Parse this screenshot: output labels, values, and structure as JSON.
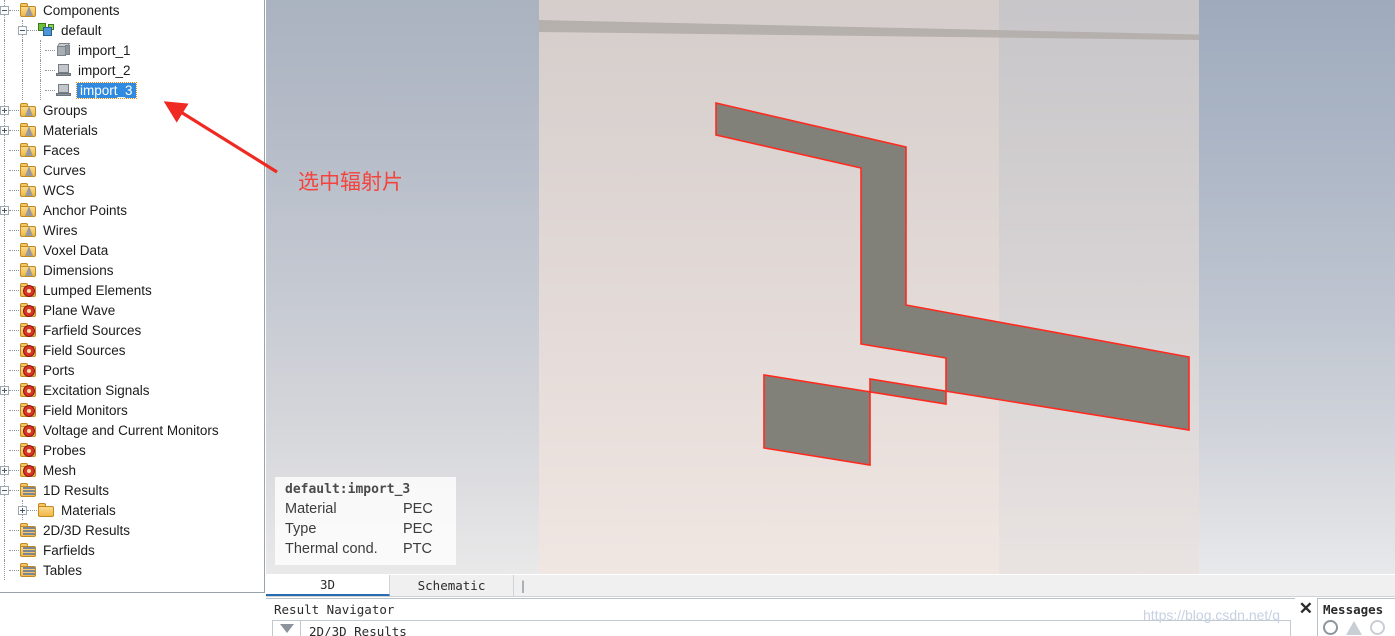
{
  "tree": {
    "items": [
      {
        "label": "Components",
        "depth": 0,
        "twisty": "minus",
        "icon": "folder-cone-icon"
      },
      {
        "label": "default",
        "depth": 1,
        "twisty": "minus",
        "icon": "component-group-icon"
      },
      {
        "label": "import_1",
        "depth": 2,
        "twisty": "none",
        "icon": "solid-body-icon"
      },
      {
        "label": "import_2",
        "depth": 2,
        "twisty": "none",
        "icon": "sheet-body-icon"
      },
      {
        "label": "import_3",
        "depth": 2,
        "twisty": "none",
        "icon": "sheet-body-icon",
        "selected": true
      },
      {
        "label": "Groups",
        "depth": 0,
        "twisty": "plus",
        "icon": "folder-cone-icon"
      },
      {
        "label": "Materials",
        "depth": 0,
        "twisty": "plus",
        "icon": "folder-cone-icon"
      },
      {
        "label": "Faces",
        "depth": 0,
        "twisty": "none",
        "icon": "folder-cone-icon"
      },
      {
        "label": "Curves",
        "depth": 0,
        "twisty": "none",
        "icon": "folder-cone-icon"
      },
      {
        "label": "WCS",
        "depth": 0,
        "twisty": "none",
        "icon": "folder-cone-icon"
      },
      {
        "label": "Anchor Points",
        "depth": 0,
        "twisty": "plus",
        "icon": "folder-cone-icon"
      },
      {
        "label": "Wires",
        "depth": 0,
        "twisty": "none",
        "icon": "folder-cone-icon"
      },
      {
        "label": "Voxel Data",
        "depth": 0,
        "twisty": "none",
        "icon": "folder-cone-icon"
      },
      {
        "label": "Dimensions",
        "depth": 0,
        "twisty": "none",
        "icon": "folder-cone-icon"
      },
      {
        "label": "Lumped Elements",
        "depth": 0,
        "twisty": "none",
        "icon": "folder-gear-icon"
      },
      {
        "label": "Plane Wave",
        "depth": 0,
        "twisty": "none",
        "icon": "folder-gear-icon"
      },
      {
        "label": "Farfield Sources",
        "depth": 0,
        "twisty": "none",
        "icon": "folder-gear-icon"
      },
      {
        "label": "Field Sources",
        "depth": 0,
        "twisty": "none",
        "icon": "folder-gear-icon"
      },
      {
        "label": "Ports",
        "depth": 0,
        "twisty": "none",
        "icon": "folder-gear-icon"
      },
      {
        "label": "Excitation Signals",
        "depth": 0,
        "twisty": "plus",
        "icon": "folder-gear-icon"
      },
      {
        "label": "Field Monitors",
        "depth": 0,
        "twisty": "none",
        "icon": "folder-gear-icon"
      },
      {
        "label": "Voltage and Current Monitors",
        "depth": 0,
        "twisty": "none",
        "icon": "folder-gear-icon"
      },
      {
        "label": "Probes",
        "depth": 0,
        "twisty": "none",
        "icon": "folder-gear-icon"
      },
      {
        "label": "Mesh",
        "depth": 0,
        "twisty": "plus",
        "icon": "folder-gear-icon"
      },
      {
        "label": "1D Results",
        "depth": 0,
        "twisty": "minus",
        "icon": "folder-results-icon"
      },
      {
        "label": "Materials",
        "depth": 1,
        "twisty": "plus",
        "icon": "folder-plain-icon"
      },
      {
        "label": "2D/3D Results",
        "depth": 0,
        "twisty": "none",
        "icon": "folder-results-icon"
      },
      {
        "label": "Farfields",
        "depth": 0,
        "twisty": "none",
        "icon": "folder-results-icon"
      },
      {
        "label": "Tables",
        "depth": 0,
        "twisty": "none",
        "icon": "folder-results-icon"
      }
    ]
  },
  "annotation": {
    "text": "选中辐射片",
    "color": "#f4433c"
  },
  "viewport": {
    "selection_outline_color": "#ff2a1f",
    "patch_fill_color": "#828179",
    "info": {
      "title": "default:import_3",
      "rows": [
        {
          "key": "Material",
          "value": "PEC"
        },
        {
          "key": "Type",
          "value": "PEC"
        },
        {
          "key": "Thermal cond.",
          "value": "PTC"
        }
      ]
    }
  },
  "view_tabs": {
    "items": [
      {
        "label": "3D",
        "active": true
      },
      {
        "label": "Schematic",
        "active": false
      }
    ],
    "caret": "|"
  },
  "result_navigator": {
    "title": "Result Navigator",
    "column_label": "2D/3D Results",
    "close_label": "✕"
  },
  "messages": {
    "title": "Messages"
  },
  "watermark": {
    "text": "https://blog.csdn.net/q"
  }
}
